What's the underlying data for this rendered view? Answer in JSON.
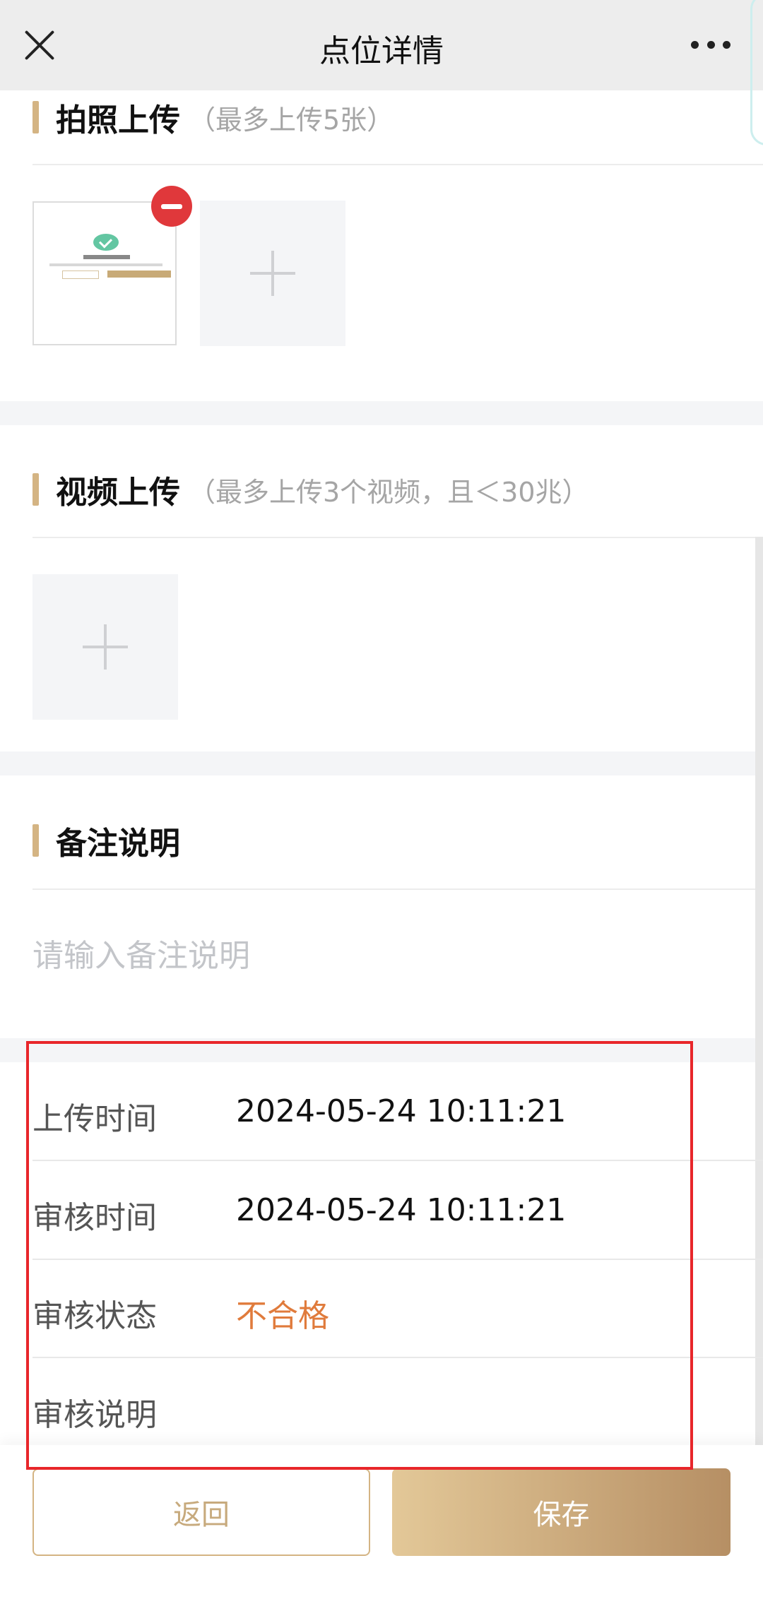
{
  "nav": {
    "title": "点位详情"
  },
  "photo": {
    "title": "拍照上传",
    "hint": "（最多上传5张）"
  },
  "video": {
    "title": "视频上传",
    "hint": "（最多上传3个视频，且＜30兆）"
  },
  "remark": {
    "title": "备注说明",
    "placeholder": "请输入备注说明"
  },
  "info": {
    "rows": [
      {
        "label": "上传时间",
        "value": "2024-05-24 10:11:21"
      },
      {
        "label": "审核时间",
        "value": "2024-05-24 10:11:21"
      },
      {
        "label": "审核状态",
        "value": "不合格",
        "color": "#e07b3c"
      },
      {
        "label": "审核说明",
        "value": ""
      }
    ]
  },
  "buttons": {
    "back": "返回",
    "save": "保存"
  },
  "colors": {
    "accent": "#d4b483",
    "danger": "#e0383b",
    "status_fail": "#e07b3c"
  }
}
